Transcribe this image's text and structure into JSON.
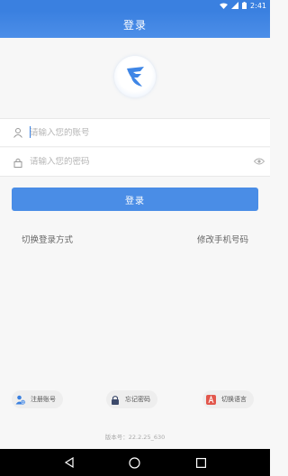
{
  "status_bar": {
    "time": "2:41",
    "icons": [
      "wifi-icon",
      "signal-icon",
      "battery-icon"
    ]
  },
  "header": {
    "title": "登录"
  },
  "logo": {
    "icon": "app-logo-icon"
  },
  "form": {
    "account": {
      "placeholder": "请输入您的账号",
      "value": "",
      "icon": "user-icon"
    },
    "password": {
      "placeholder": "请输入您的密码",
      "value": "",
      "icon": "lock-icon",
      "toggle_icon": "eye-icon"
    },
    "login_button": "登录"
  },
  "links": {
    "switch_login": "切换登录方式",
    "change_phone": "修改手机号码"
  },
  "bottom_actions": [
    {
      "label": "注册账号",
      "icon": "register-user-icon"
    },
    {
      "label": "忘记密码",
      "icon": "lock-icon"
    },
    {
      "label": "切换语言",
      "icon": "language-icon"
    }
  ],
  "version": "版本号：22.2.25_630",
  "nav_bar": {
    "buttons": [
      "back-icon",
      "home-icon",
      "recents-icon"
    ]
  },
  "colors": {
    "primary": "#3a80e0",
    "button": "#4a8de6",
    "background": "#f7f7f7",
    "logo_accent": "#3f86e6",
    "language_accent": "#e2574c"
  }
}
